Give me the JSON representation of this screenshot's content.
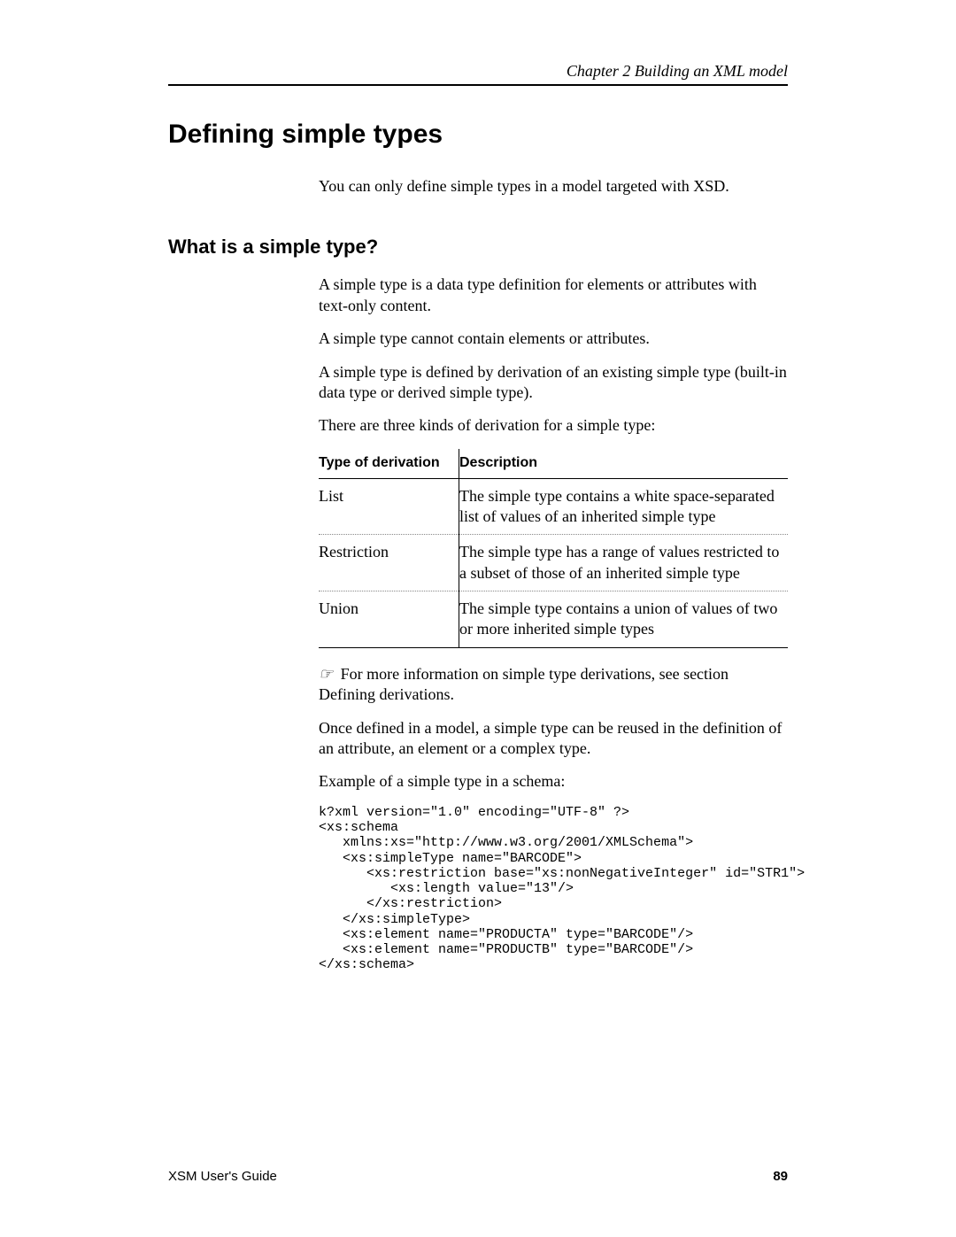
{
  "running_head": "Chapter 2  Building an XML model",
  "title": "Defining simple types",
  "intro": "You can only define simple types in a model targeted with XSD.",
  "section_title": "What is a simple type?",
  "p1": "A simple type is a data type definition for elements or attributes with text-only content.",
  "p2": "A simple type cannot contain elements or attributes.",
  "p3": "A simple type is defined by derivation of an existing simple type (built-in data type or derived simple type).",
  "p4": "There are three kinds of derivation for a simple type:",
  "table": {
    "h1": "Type of derivation",
    "h2": "Description",
    "rows": [
      {
        "c1": "List",
        "c2": "The simple type contains a white space-separated list of values of an inherited simple type"
      },
      {
        "c1": "Restriction",
        "c2": "The simple type has a range of values restricted to a subset of those of an inherited simple type"
      },
      {
        "c1": "Union",
        "c2": "The simple type contains a union of values of two or more inherited simple types"
      }
    ]
  },
  "note_icon": "☞",
  "note": " For more information on simple type derivations, see section Defining derivations.",
  "p5": "Once defined in a model, a simple type can be reused in the definition of an attribute, an element or a complex type.",
  "p6": "Example of a simple type in a schema:",
  "code": "k?xml version=\"1.0\" encoding=\"UTF-8\" ?>\n<xs:schema\n   xmlns:xs=\"http://www.w3.org/2001/XMLSchema\">\n   <xs:simpleType name=\"BARCODE\">\n      <xs:restriction base=\"xs:nonNegativeInteger\" id=\"STR1\">\n         <xs:length value=\"13\"/>\n      </xs:restriction>\n   </xs:simpleType>\n   <xs:element name=\"PRODUCTA\" type=\"BARCODE\"/>\n   <xs:element name=\"PRODUCTB\" type=\"BARCODE\"/>\n</xs:schema>",
  "footer_left": "XSM User's Guide",
  "footer_right": "89"
}
